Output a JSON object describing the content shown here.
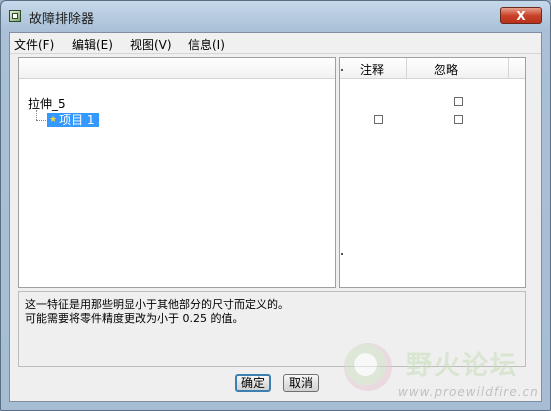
{
  "window": {
    "title": "故障排除器",
    "close_label": "X"
  },
  "menu": {
    "file": "文件(F)",
    "edit": "编辑(E)",
    "view": "视图(V)",
    "info": "信息(I)"
  },
  "columns": {
    "note": "注释",
    "ignore": "忽略"
  },
  "tree": {
    "root_label": "拉伸_5",
    "child_label": "项目 1",
    "root_note_visible": false,
    "root_ignore_checked": false,
    "child_note_checked": false,
    "child_ignore_checked": false
  },
  "message": {
    "line1": "这一特征是用那些明显小于其他部分的尺寸而定义的。",
    "line2": "可能需要将零件精度更改为小于  0.25  的值。"
  },
  "buttons": {
    "ok": "确定",
    "cancel": "取消"
  },
  "watermark": {
    "text": "野火论坛",
    "url": "www.proewildfire.cn"
  },
  "colors": {
    "selection": "#3399ff",
    "close_button": "#c9432a"
  }
}
